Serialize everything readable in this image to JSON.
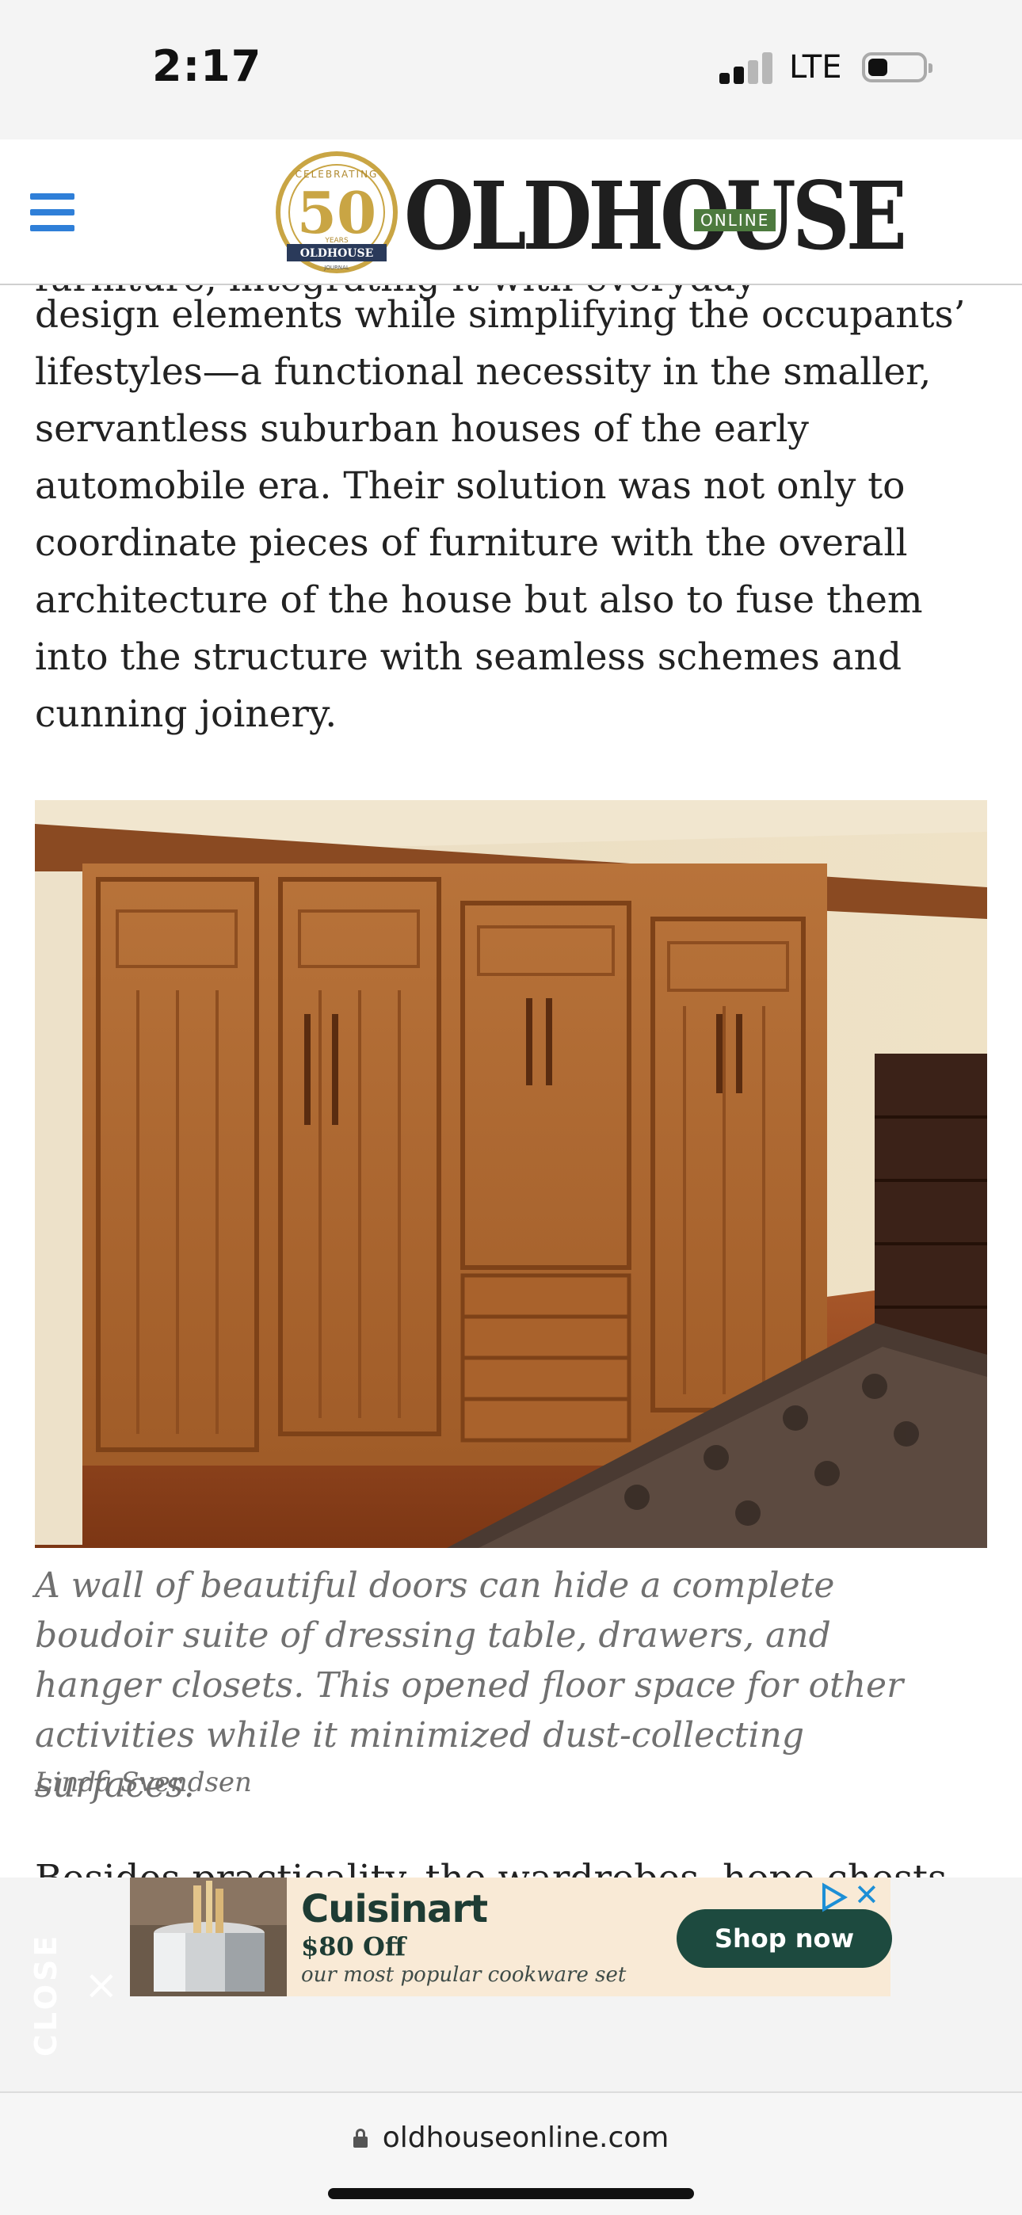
{
  "status_bar": {
    "time": "2:17",
    "network": "LTE"
  },
  "header": {
    "logo_word": "OLDHOUSE",
    "logo_online": "ONLINE",
    "badge_number": "50",
    "badge_top": "CELEBRATING",
    "badge_years": "YEARS",
    "badge_brand": "OLDHOUSE",
    "badge_sub": "JOURNAL"
  },
  "article": {
    "cut_line": "furniture, integrating it with everyday",
    "paragraph": "design elements while simplifying the occupants’ lifestyles—a functional necessity in the smaller, servantless suburban houses of the early automobile era. Their solution was not only to coordinate pieces of furniture with the overall architecture of the house but also to fuse them into the structure with seamless schemes and cunning joinery.",
    "photo_alt": "Built-in wall of oak closet doors and drawers",
    "caption": "A wall of beautiful doors can hide a complete boudoir suite of dressing table, drawers, and hanger closets. This opened floor space for other activities while it minimized dust-collecting surfaces.",
    "credit": "Linda Svendsen",
    "next_line": "Besides practicality, the wardrobes, hope chests..."
  },
  "ad": {
    "close_label": "CLOSE",
    "close_x": "×",
    "brand": "Cuisinart",
    "offer": "$80 Off",
    "subtext": "our most popular cookware set",
    "cta": "Shop now",
    "dismiss": "✕"
  },
  "browser": {
    "url": "oldhouseonline.com"
  },
  "colors": {
    "accent": "#2f7fd8",
    "ad_cta": "#1d4a3f",
    "caption": "#707070"
  }
}
